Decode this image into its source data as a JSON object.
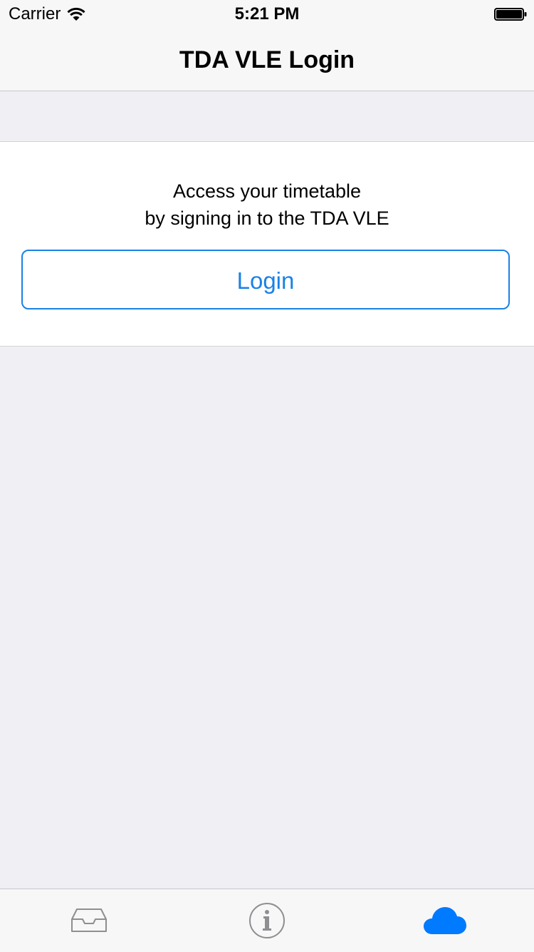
{
  "status_bar": {
    "carrier": "Carrier",
    "time": "5:21 PM"
  },
  "nav": {
    "title": "TDA VLE Login"
  },
  "card": {
    "line1": "Access your timetable",
    "line2": "by signing in to the TDA VLE",
    "login_label": "Login"
  },
  "tab_bar": {
    "tabs": [
      {
        "icon": "inbox-icon",
        "selected": false
      },
      {
        "icon": "info-icon",
        "selected": false
      },
      {
        "icon": "cloud-icon",
        "selected": true
      }
    ]
  },
  "colors": {
    "accent": "#1a82e6",
    "tab_selected": "#007aff",
    "tab_unselected": "#8e8e93",
    "background": "#efeff4"
  }
}
